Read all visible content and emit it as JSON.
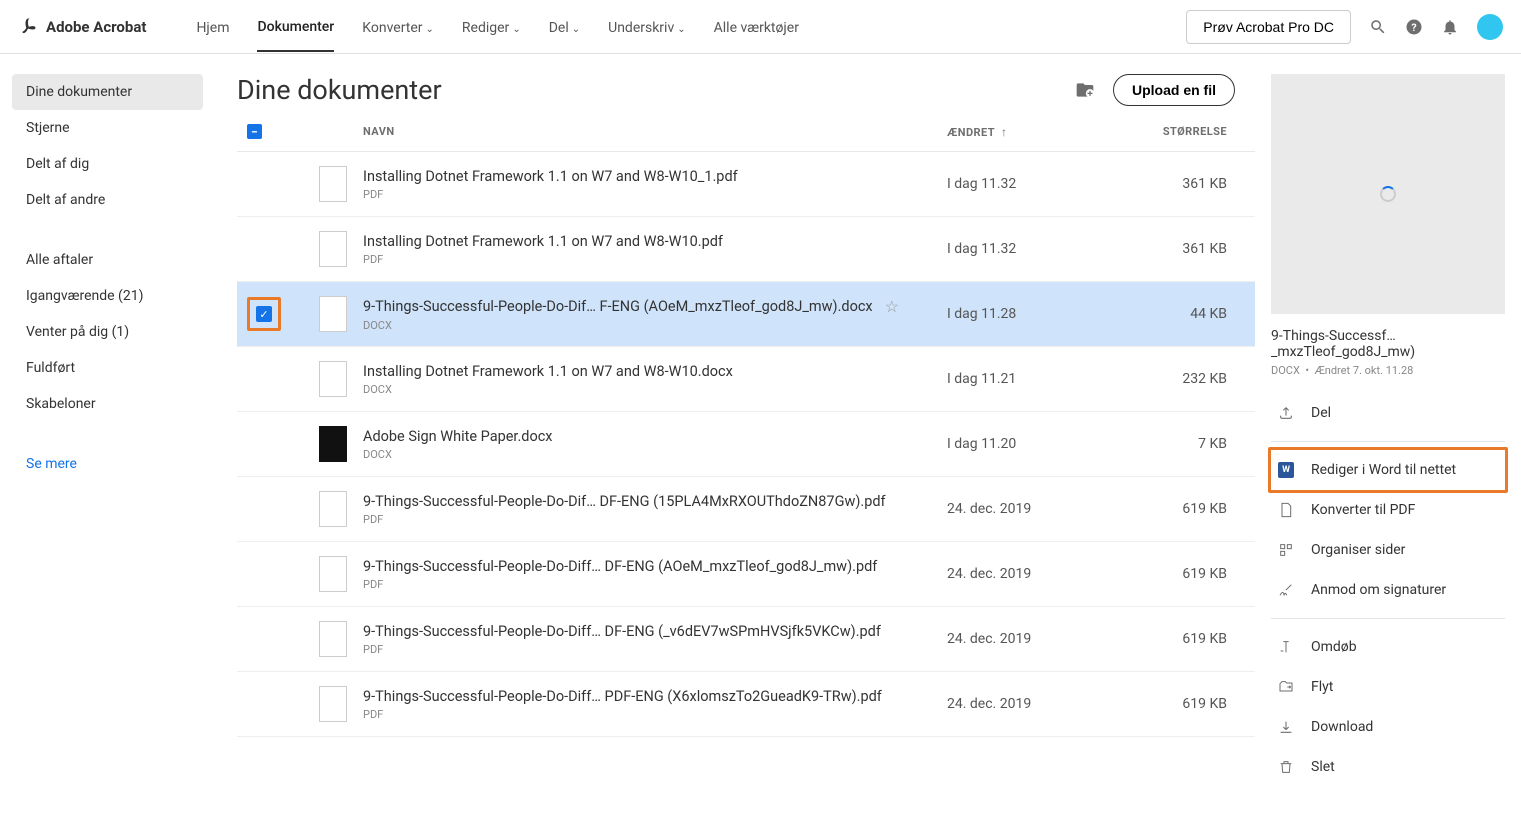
{
  "app_name": "Adobe Acrobat",
  "topnav": {
    "home": "Hjem",
    "documents": "Dokumenter",
    "convert": "Konverter",
    "edit": "Rediger",
    "share": "Del",
    "sign": "Underskriv",
    "all_tools": "Alle værktøjer"
  },
  "try_button": "Prøv Acrobat Pro DC",
  "sidebar": {
    "group1": [
      "Dine dokumenter",
      "Stjerne",
      "Delt af dig",
      "Delt af andre"
    ],
    "group2": [
      "Alle aftaler",
      "Igangværende (21)",
      "Venter på dig (1)",
      "Fuldført",
      "Skabeloner"
    ],
    "see_more": "Se mere"
  },
  "page_title": "Dine dokumenter",
  "upload_button": "Upload en fil",
  "columns": {
    "name": "NAVN",
    "modified": "ÆNDRET",
    "size": "STØRRELSE"
  },
  "files": [
    {
      "name": "Installing Dotnet Framework 1.1 on W7 and W8-W10_1.pdf",
      "type": "PDF",
      "modified": "I dag 11.32",
      "size": "361 KB",
      "selected": false,
      "thumb": "doc"
    },
    {
      "name": "Installing Dotnet Framework 1.1 on W7 and W8-W10.pdf",
      "type": "PDF",
      "modified": "I dag 11.32",
      "size": "361 KB",
      "selected": false,
      "thumb": "doc"
    },
    {
      "name": "9-Things-Successful-People-Do-Dif… F-ENG (AOeM_mxzTleof_god8J_mw).docx",
      "type": "DOCX",
      "modified": "I dag 11.28",
      "size": "44 KB",
      "selected": true,
      "star": true,
      "thumb": "doc"
    },
    {
      "name": "Installing Dotnet Framework 1.1 on W7 and W8-W10.docx",
      "type": "DOCX",
      "modified": "I dag 11.21",
      "size": "232 KB",
      "selected": false,
      "thumb": "doc"
    },
    {
      "name": "Adobe Sign White Paper.docx",
      "type": "DOCX",
      "modified": "I dag 11.20",
      "size": "7 KB",
      "selected": false,
      "thumb": "black"
    },
    {
      "name": "9-Things-Successful-People-Do-Dif… DF-ENG (15PLA4MxRXOUThdoZN87Gw).pdf",
      "type": "PDF",
      "modified": "24. dec. 2019",
      "size": "619 KB",
      "selected": false,
      "thumb": "doc"
    },
    {
      "name": "9-Things-Successful-People-Do-Diff… DF-ENG (AOeM_mxzTleof_god8J_mw).pdf",
      "type": "PDF",
      "modified": "24. dec. 2019",
      "size": "619 KB",
      "selected": false,
      "thumb": "doc"
    },
    {
      "name": "9-Things-Successful-People-Do-Diff… DF-ENG (_v6dEV7wSPmHVSjfk5VKCw).pdf",
      "type": "PDF",
      "modified": "24. dec. 2019",
      "size": "619 KB",
      "selected": false,
      "thumb": "doc"
    },
    {
      "name": "9-Things-Successful-People-Do-Diff…  PDF-ENG (X6xlomszTo2GueadK9-TRw).pdf",
      "type": "PDF",
      "modified": "24. dec. 2019",
      "size": "619 KB",
      "selected": false,
      "thumb": "doc"
    }
  ],
  "preview": {
    "title": "9-Things-Successf… _mxzTleof_god8J_mw)",
    "meta_type": "DOCX",
    "meta_sep": "•",
    "meta_date": "Ændret  7. okt. 11.28"
  },
  "actions": {
    "share": "Del",
    "edit_word": "Rediger i Word til nettet",
    "convert_pdf": "Konverter til PDF",
    "organize": "Organiser sider",
    "request_sig": "Anmod om signaturer",
    "rename": "Omdøb",
    "move": "Flyt",
    "download": "Download",
    "delete": "Slet"
  }
}
